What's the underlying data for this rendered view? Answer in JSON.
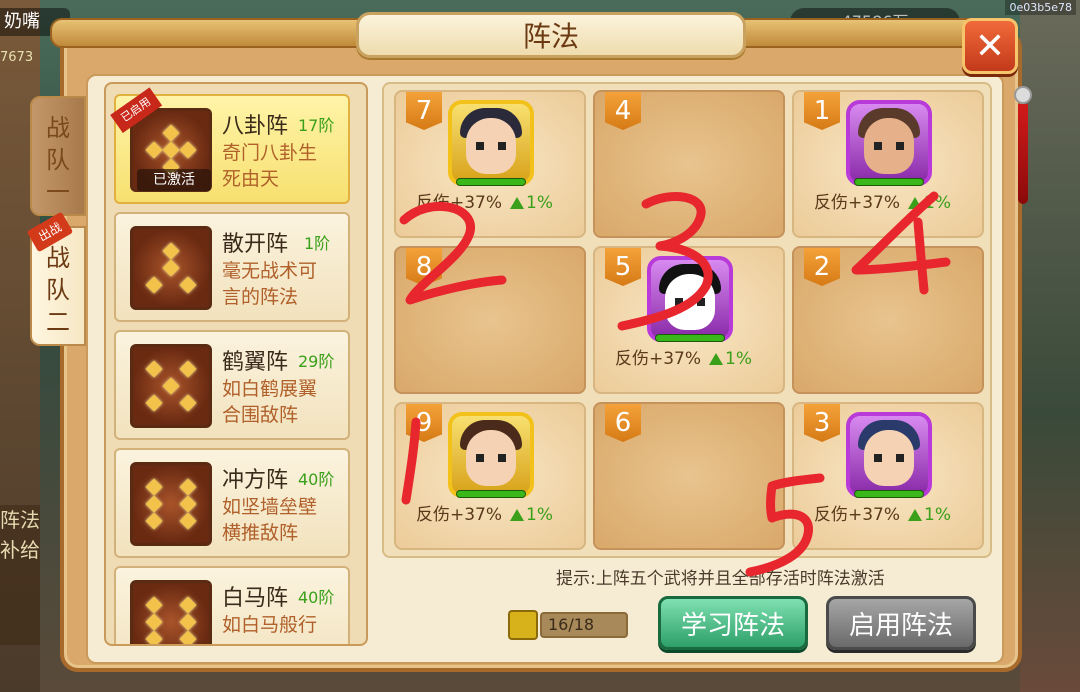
{
  "background": {
    "player_name_fragment": "奶嘴",
    "number_fragment": "7673",
    "coins_fragment": "47586万",
    "session_id": "0e03b5e78"
  },
  "dialog": {
    "title": "阵法",
    "close_label": "✕"
  },
  "team_tabs": [
    {
      "label_line1": "战",
      "label_line2": "队",
      "label_line3": "一"
    },
    {
      "label_line1": "战",
      "label_line2": "队",
      "label_line3": "二",
      "badge": "出战"
    }
  ],
  "left_bottom": {
    "text": "阵法补给"
  },
  "formations": [
    {
      "name": "八卦阵",
      "level": "17阶",
      "desc_line1": "奇门八卦生",
      "desc_line2": "死由天",
      "stamp": "已激活",
      "ribbon": "已启用"
    },
    {
      "name": "散开阵",
      "level": "1阶",
      "desc_line1": "毫无战术可",
      "desc_line2": "言的阵法"
    },
    {
      "name": "鹤翼阵",
      "level": "29阶",
      "desc_line1": "如白鹤展翼",
      "desc_line2": "合围敌阵"
    },
    {
      "name": "冲方阵",
      "level": "40阶",
      "desc_line1": "如坚墙垒壁",
      "desc_line2": "横推敌阵"
    },
    {
      "name": "白马阵",
      "level": "40阶",
      "desc_line1": "如白马般行",
      "desc_line2": ""
    }
  ],
  "grid": [
    {
      "num": "7",
      "hero": true,
      "stat": "反伤+37%",
      "bonus": "1%"
    },
    {
      "num": "4",
      "hero": false
    },
    {
      "num": "1",
      "hero": true,
      "stat": "反伤+37%",
      "bonus": "1%"
    },
    {
      "num": "8",
      "hero": false
    },
    {
      "num": "5",
      "hero": true,
      "stat": "反伤+37%",
      "bonus": "1%"
    },
    {
      "num": "2",
      "hero": false
    },
    {
      "num": "9",
      "hero": true,
      "stat": "反伤+37%",
      "bonus": "1%"
    },
    {
      "num": "6",
      "hero": false
    },
    {
      "num": "3",
      "hero": true,
      "stat": "反伤+37%",
      "bonus": "1%"
    }
  ],
  "hint": "提示:上阵五个武将并且全部存活时阵法激活",
  "book_count": "16/18",
  "buttons": {
    "learn": "学习阵法",
    "use": "启用阵法"
  },
  "annotations": [
    "2",
    "3",
    "4",
    "1",
    "5"
  ],
  "colors": {
    "annotation_red": "#e8262e",
    "level_green": "#3aa01a",
    "desc_brown": "#b0602a"
  }
}
